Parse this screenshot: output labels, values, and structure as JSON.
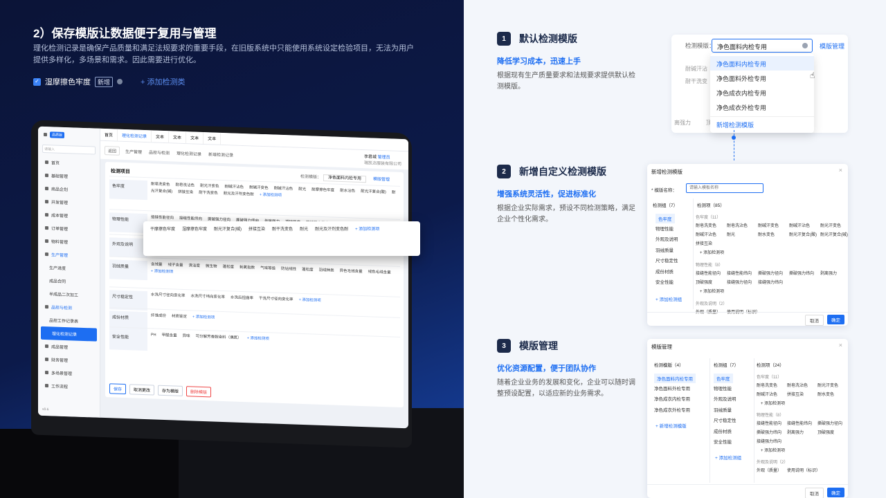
{
  "left": {
    "title": "2）保存模版让数据便于复用与管理",
    "intro": "理化检测记录是确保产品质量和满足法规要求的重要手段，在旧版系统中只能使用系统设定检验项目，无法为用户提供多样化，多场景和需求。因此需要进行优化。",
    "item": "湿摩擦色牢度",
    "new_tag": "新增",
    "add_link": "+ 添加检测类"
  },
  "app": {
    "sidebar_badge": "品质版",
    "search_placeholder": "请输入",
    "menu": [
      "首页",
      "基础管理",
      "商品企划",
      "开发管理",
      "成本管理",
      "订单管理",
      "物料管理",
      "生产管理",
      "生产进度",
      "成品合同",
      "半成品二次加工",
      "品控与检测",
      "品控工作记录表",
      "理化检测记录",
      "成品管理",
      "财务管理",
      "多场景管理",
      "工作流程"
    ],
    "version": "v0.6",
    "tabs": [
      "首页",
      "理化检测记录",
      "文本",
      "文本",
      "文本",
      "文本"
    ],
    "back": "返回",
    "breadcrumb": [
      "生产管理",
      "品控与检测",
      "理化检测记录",
      "新增检测记录"
    ],
    "user_name": "李君城",
    "user_role": "管理员",
    "user_org": "瑞凯达服装有限公司",
    "card_title": "检测项目",
    "template_label": "检测模版：",
    "template_value": "净色面料内检专用",
    "template_manage": "模版管理",
    "groups": [
      {
        "name": "色牢度",
        "items": [
          "耐皂洗变色",
          "耐皂洗沾色",
          "耐光汗变色",
          "耐碱汗沾色",
          "耐碱汗变色",
          "耐碱汗沾色",
          "耐光",
          "耐摩擦色牢度",
          "耐水沾色",
          "耐光汗复合(酸)",
          "耐光汗复合(碱)",
          "拼接互染",
          "耐干洗变色",
          "耐光及汗剂变色耐"
        ]
      },
      {
        "name": "物理性能",
        "items": [
          "接缝性能径向",
          "接缝性能纬向",
          "撕破强力径向",
          "撕破强力纬向",
          "剥离强力",
          "顶破强度",
          "接缝强力径向",
          "接缝强力纬向",
          "耐磨变色",
          "耐磨性能"
        ]
      },
      {
        "name": "外观及说明",
        "items": [
          "外观（质量）",
          "使用说明（标识）"
        ]
      },
      {
        "name": "羽绒质量",
        "items": [
          "含绒量",
          "绒子含量",
          "清洁度",
          "微生物",
          "蓬松度",
          "耗氧指数",
          "气味等级",
          "防钻绒性",
          "蓬松度",
          "羽绒种类",
          "异色毛绒含量",
          "绒色毛绒含量"
        ]
      },
      {
        "name": "尺寸稳定性",
        "items": [
          "水洗尺寸径向变化率",
          "水洗尺寸纬向变化率",
          "水洗后扭曲率",
          "干洗尺寸径向变化率"
        ]
      },
      {
        "name": "成份材质",
        "items": [
          "纤维成份",
          "材质鉴定"
        ]
      },
      {
        "name": "安全性能",
        "items": [
          "PH",
          "甲醛含量",
          "异味",
          "可分解芳香胺染料（偶氮）"
        ]
      }
    ],
    "popout_items": [
      "干摩擦色牢度",
      "湿摩擦色牢度",
      "耐光汗复合(碱)",
      "拼接互染",
      "耐干洗变色",
      "耐光",
      "耐光及汗剂变色耐"
    ],
    "add_item": "+ 添加检测项",
    "buttons": [
      "保存",
      "取消更改",
      "存为模版",
      "删除模版"
    ]
  },
  "sections": [
    {
      "num": "1",
      "title": "默认检测模版",
      "sub": "降低学习成本，迅速上手",
      "desc": "根据现有生产质量要求和法规要求提供默认检测模版。"
    },
    {
      "num": "2",
      "title": "新增自定义检测模版",
      "sub": "增强系统灵活性，促进标准化",
      "desc": "根据企业实际需求，预设不同检测策略，满足企业个性化需求。"
    },
    {
      "num": "3",
      "title": "模版管理",
      "sub": "优化资源配置，便于团队协作",
      "desc": "随着企业业务的发展和变化，企业可以随时调整预设配置，以适应新的业务需求。"
    }
  ],
  "dropdown": {
    "label": "检测模版：",
    "value": "净色面料内检专用",
    "manage": "模版管理",
    "options": [
      "净色面料内检专用",
      "净色面料外检专用",
      "净色成衣内检专用",
      "净色成衣外检专用"
    ],
    "add": "新增检测模版",
    "ghost": [
      "耐碱汗沾",
      "耐干洗变",
      "离强力",
      "顶"
    ]
  },
  "new_dialog": {
    "title": "新增检测模版",
    "name_label": "* 模版名称：",
    "name_placeholder": "请输入模板名称",
    "group_header": "检测组（7）",
    "item_header": "检测项（85）",
    "groups": [
      "色牢度",
      "物理性能",
      "外观及说明",
      "羽绒质量",
      "尺寸稳定性",
      "成份材质",
      "安全性能"
    ],
    "add_group": "+ 添加检测组",
    "sections": [
      {
        "cap": "色牢度（11）",
        "items": [
          "耐皂洗变色",
          "耐皂洗沾色",
          "耐碱汗变色",
          "耐碱汗沾色",
          "耐光汗变色",
          "耐碱汗沾色",
          "耐光",
          "耐水变色",
          "耐光汗复合(酸)",
          "耐光汗复合(碱)",
          "拼接互染"
        ]
      },
      {
        "cap": "物理性能（8）",
        "items": [
          "接缝性能径向",
          "接缝性能纬向",
          "撕破强力径向",
          "撕破强力纬向",
          "剥离强力",
          "顶破强度",
          "接缝强力径向",
          "接缝强力纬向"
        ]
      },
      {
        "cap": "外观及说明（2）",
        "items": [
          "外观（质量）",
          "使用说明（标识）"
        ]
      }
    ],
    "add_item": "+ 添加检测项",
    "cancel": "取消",
    "ok": "确定"
  },
  "manage_dialog": {
    "title": "模版管理",
    "tpl_header": "检测模版（4）",
    "grp_header": "检测组（7）",
    "item_header": "检测项（24）",
    "templates": [
      "净色面料内检专用",
      "净色面料外检专用",
      "净色成衣内检专用",
      "净色成衣外检专用"
    ],
    "add_template": "+ 新增检测模版",
    "groups": [
      "色牢度",
      "物理性能",
      "外观及说明",
      "羽绒质量",
      "尺寸稳定性",
      "成份材质",
      "安全性能"
    ],
    "add_group": "+ 添加检测组",
    "sections": [
      {
        "cap": "色牢度（11）",
        "items": [
          "耐皂洗变色",
          "耐皂洗沾色",
          "耐光汗变色",
          "耐碱汗沾色",
          "拼接互染",
          "耐水变色"
        ]
      },
      {
        "cap": "物理性能（8）",
        "items": [
          "接缝性能径向",
          "接缝性能纬向",
          "撕破强力径向",
          "撕破强力纬向",
          "剥离强力",
          "顶破强度",
          "接缝强力纬向"
        ]
      },
      {
        "cap": "外观及说明（2）",
        "items": [
          "外观（质量）",
          "使用说明（标识）"
        ]
      }
    ],
    "add_item": "+ 添加检测项",
    "cancel": "取消",
    "ok": "确定"
  }
}
